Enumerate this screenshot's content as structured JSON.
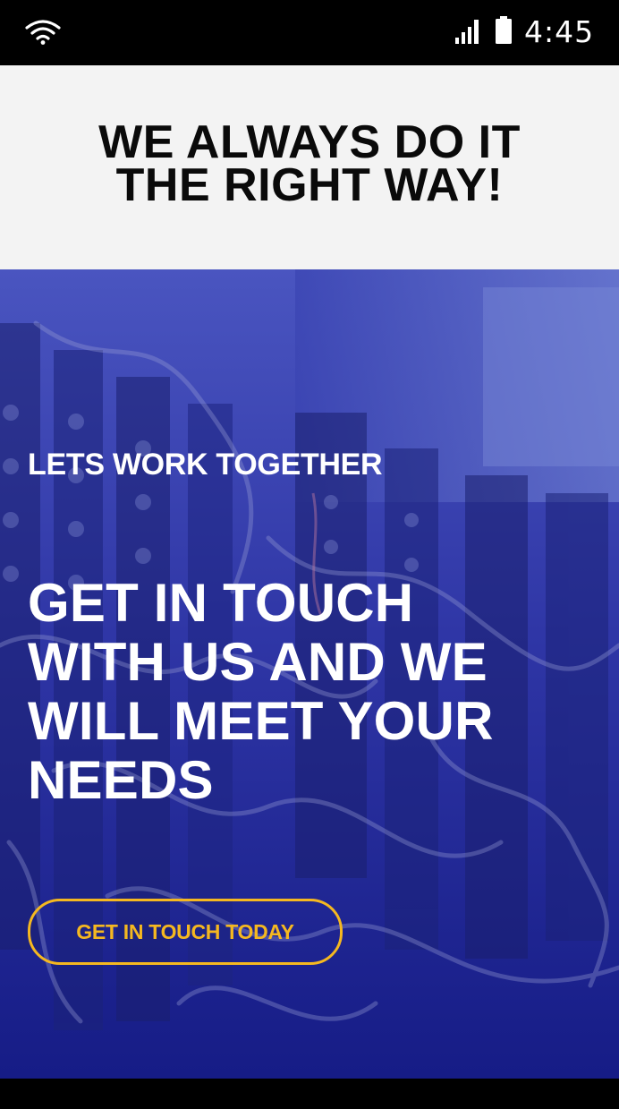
{
  "status_bar": {
    "time": "4:45",
    "icons": [
      "wifi-icon",
      "signal-icon",
      "battery-icon"
    ]
  },
  "headline": {
    "line1": "WE ALWAYS DO IT",
    "line2": "THE RIGHT WAY!"
  },
  "hero": {
    "eyebrow": "LETS WORK TOGETHER",
    "title_lines": [
      "GET IN TOUCH",
      "WITH US AND WE",
      "WILL MEET YOUR",
      "NEEDS"
    ],
    "cta_label": "GET IN TOUCH TODAY",
    "background_image": "electrical-panel-wiring"
  },
  "colors": {
    "overlay": "#2a2f9a",
    "accent": "#f5b820",
    "headline_bg": "#f3f3f3"
  }
}
